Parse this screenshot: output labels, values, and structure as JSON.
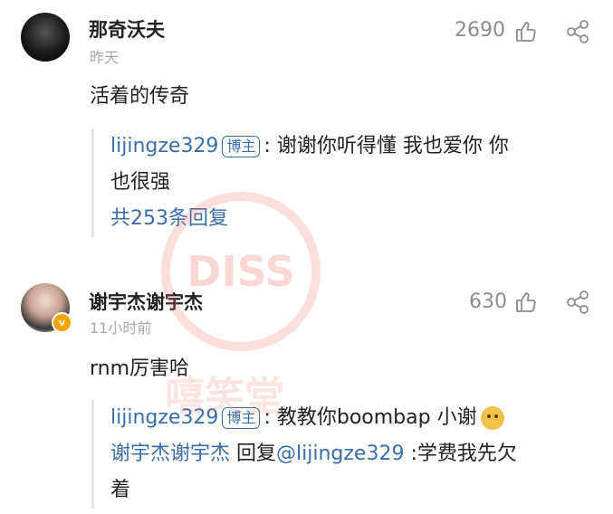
{
  "comments": [
    {
      "username": "那奇沃夫",
      "time": "昨天",
      "likes": "2690",
      "text": "活着的传奇",
      "reply": {
        "author": "lijingze329",
        "badge": "博主",
        "text_line1": ": 谢谢你听得懂 我也爱你 你",
        "text_line2": "也很强",
        "more": "共253条回复"
      }
    },
    {
      "username": "谢宇杰谢宇杰",
      "time": "11小时前",
      "likes": "630",
      "text": "rnm厉害哈",
      "verified_icon": "v-badge",
      "replies": [
        {
          "author": "lijingze329",
          "badge": "博主",
          "text": ": 教教你boombap 小谢",
          "emoji": "doge-emoji"
        },
        {
          "author": "谢宇杰谢宇杰",
          "mid": " 回复",
          "mention": "@lijingze329",
          "text_line1": " :学费我先欠",
          "text_line2": "着"
        }
      ]
    }
  ],
  "watermark": {
    "text": "DISS",
    "lower": "嘻笑堂"
  }
}
